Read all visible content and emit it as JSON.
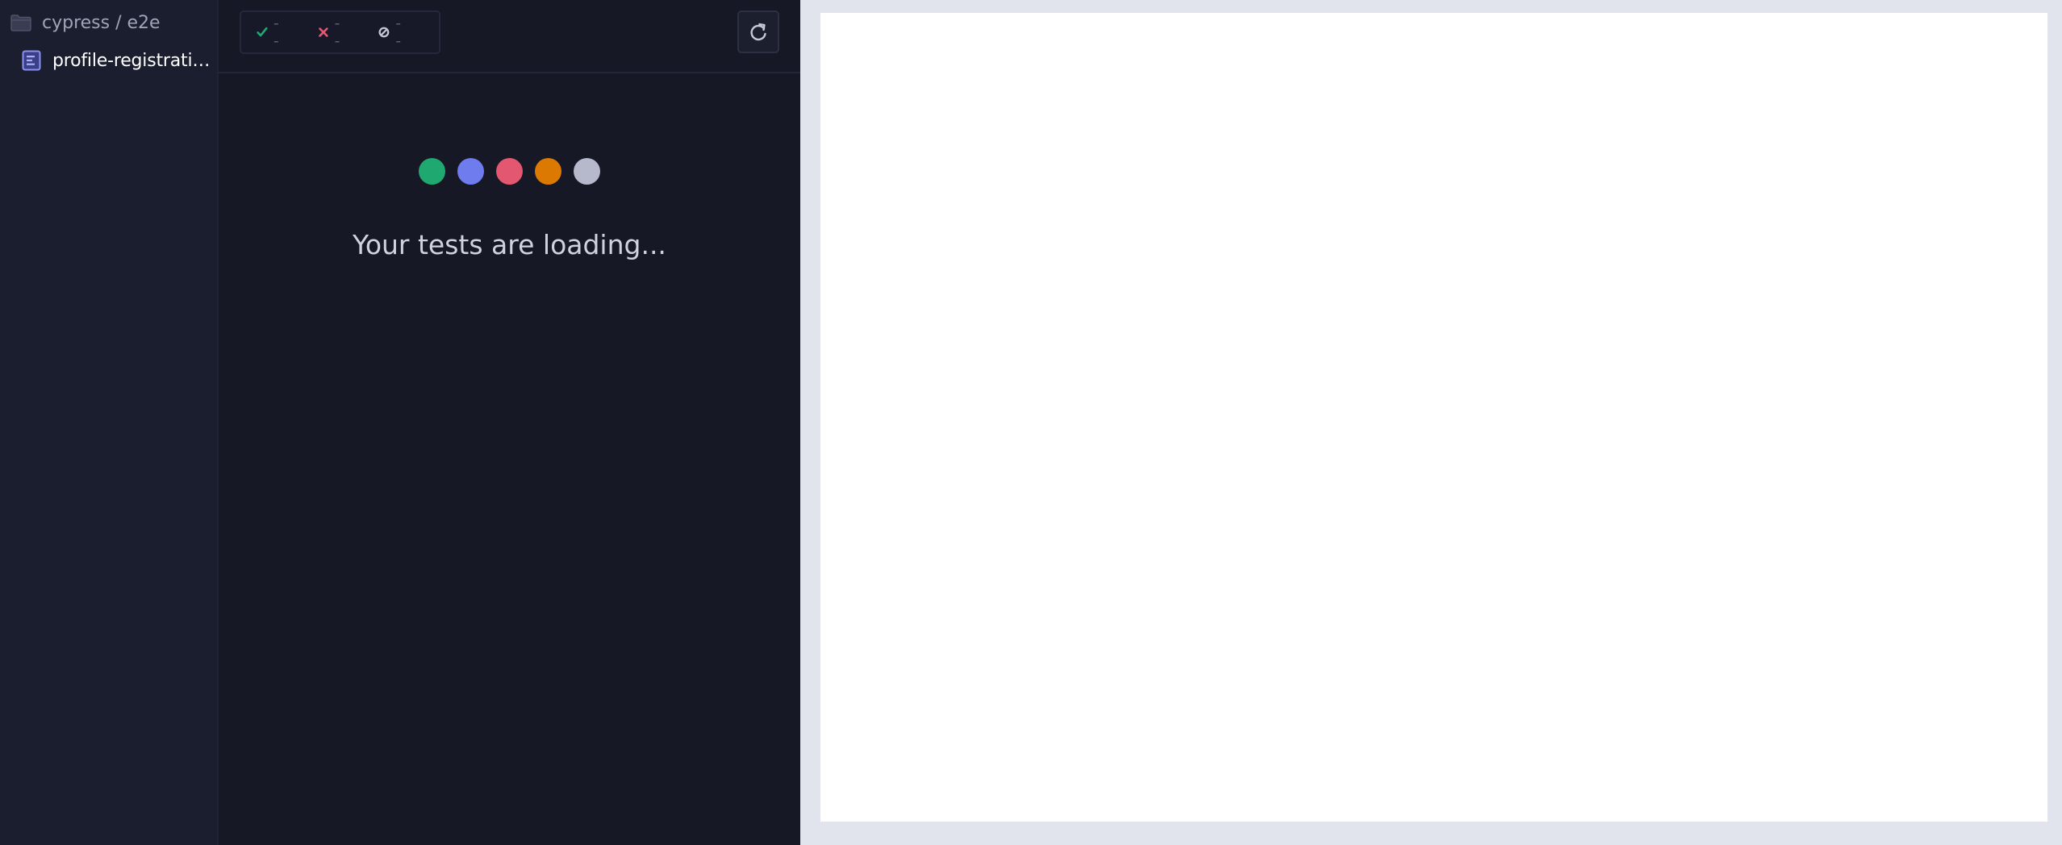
{
  "sidebar": {
    "folder": {
      "label": "cypress / e2e",
      "icon": "folder-icon"
    },
    "file": {
      "label": "profile-registration.cy.js",
      "icon": "spec-file-icon"
    }
  },
  "reporter": {
    "stats": {
      "passed": {
        "icon": "check-icon",
        "value": "--",
        "color": "#1fa971"
      },
      "failed": {
        "icon": "x-icon",
        "value": "--",
        "color": "#e45770"
      },
      "pending": {
        "icon": "skip-icon",
        "value": "--",
        "color": "#c3c5d3"
      }
    },
    "reload": {
      "icon": "reload-icon"
    },
    "loading": {
      "dots": [
        "#1fa971",
        "#6f7ced",
        "#e45770",
        "#db7903",
        "#b6b8cb"
      ],
      "text": "Your tests are loading..."
    }
  },
  "aut": {
    "background": "#ffffff"
  }
}
